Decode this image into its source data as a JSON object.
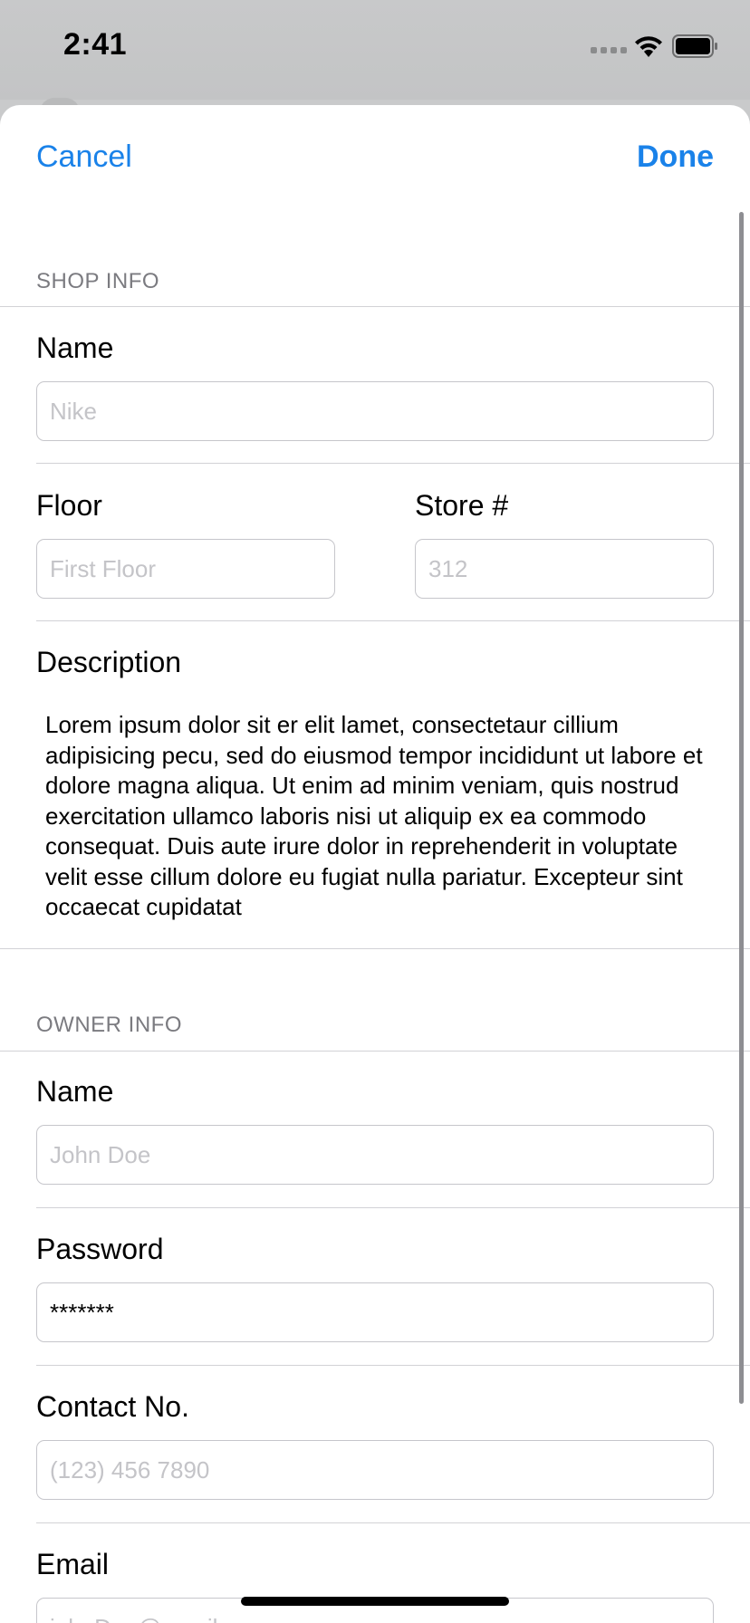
{
  "status_bar": {
    "time": "2:41",
    "icons": [
      "cell-signal-icon",
      "wifi-icon",
      "battery-icon"
    ]
  },
  "nav": {
    "cancel_label": "Cancel",
    "done_label": "Done"
  },
  "shop_info": {
    "header": "SHOP INFO",
    "name_label": "Name",
    "name_placeholder": "Nike",
    "floor_label": "Floor",
    "floor_placeholder": "First Floor",
    "store_label": "Store #",
    "store_placeholder": "312",
    "description_label": "Description",
    "description_text": "Lorem ipsum dolor sit er elit lamet, consectetaur cillium adipisicing pecu, sed do eiusmod tempor incididunt ut labore et dolore magna aliqua. Ut enim ad minim veniam, quis nostrud exercitation ullamco laboris nisi ut aliquip ex ea commodo consequat. Duis aute irure dolor in reprehenderit in voluptate velit esse cillum dolore eu fugiat nulla pariatur. Excepteur sint occaecat cupidatat"
  },
  "owner_info": {
    "header": "OWNER INFO",
    "name_label": "Name",
    "name_placeholder": "John Doe",
    "password_label": "Password",
    "password_value": "*******",
    "contact_label": "Contact No.",
    "contact_placeholder": "(123) 456 7890",
    "email_label": "Email",
    "email_placeholder": "johnDoe@gmail.com"
  },
  "colors": {
    "accent": "#1a82e9",
    "section_header": "#7b7b80",
    "placeholder": "#c4c4c8",
    "divider": "#d2d2d6"
  }
}
